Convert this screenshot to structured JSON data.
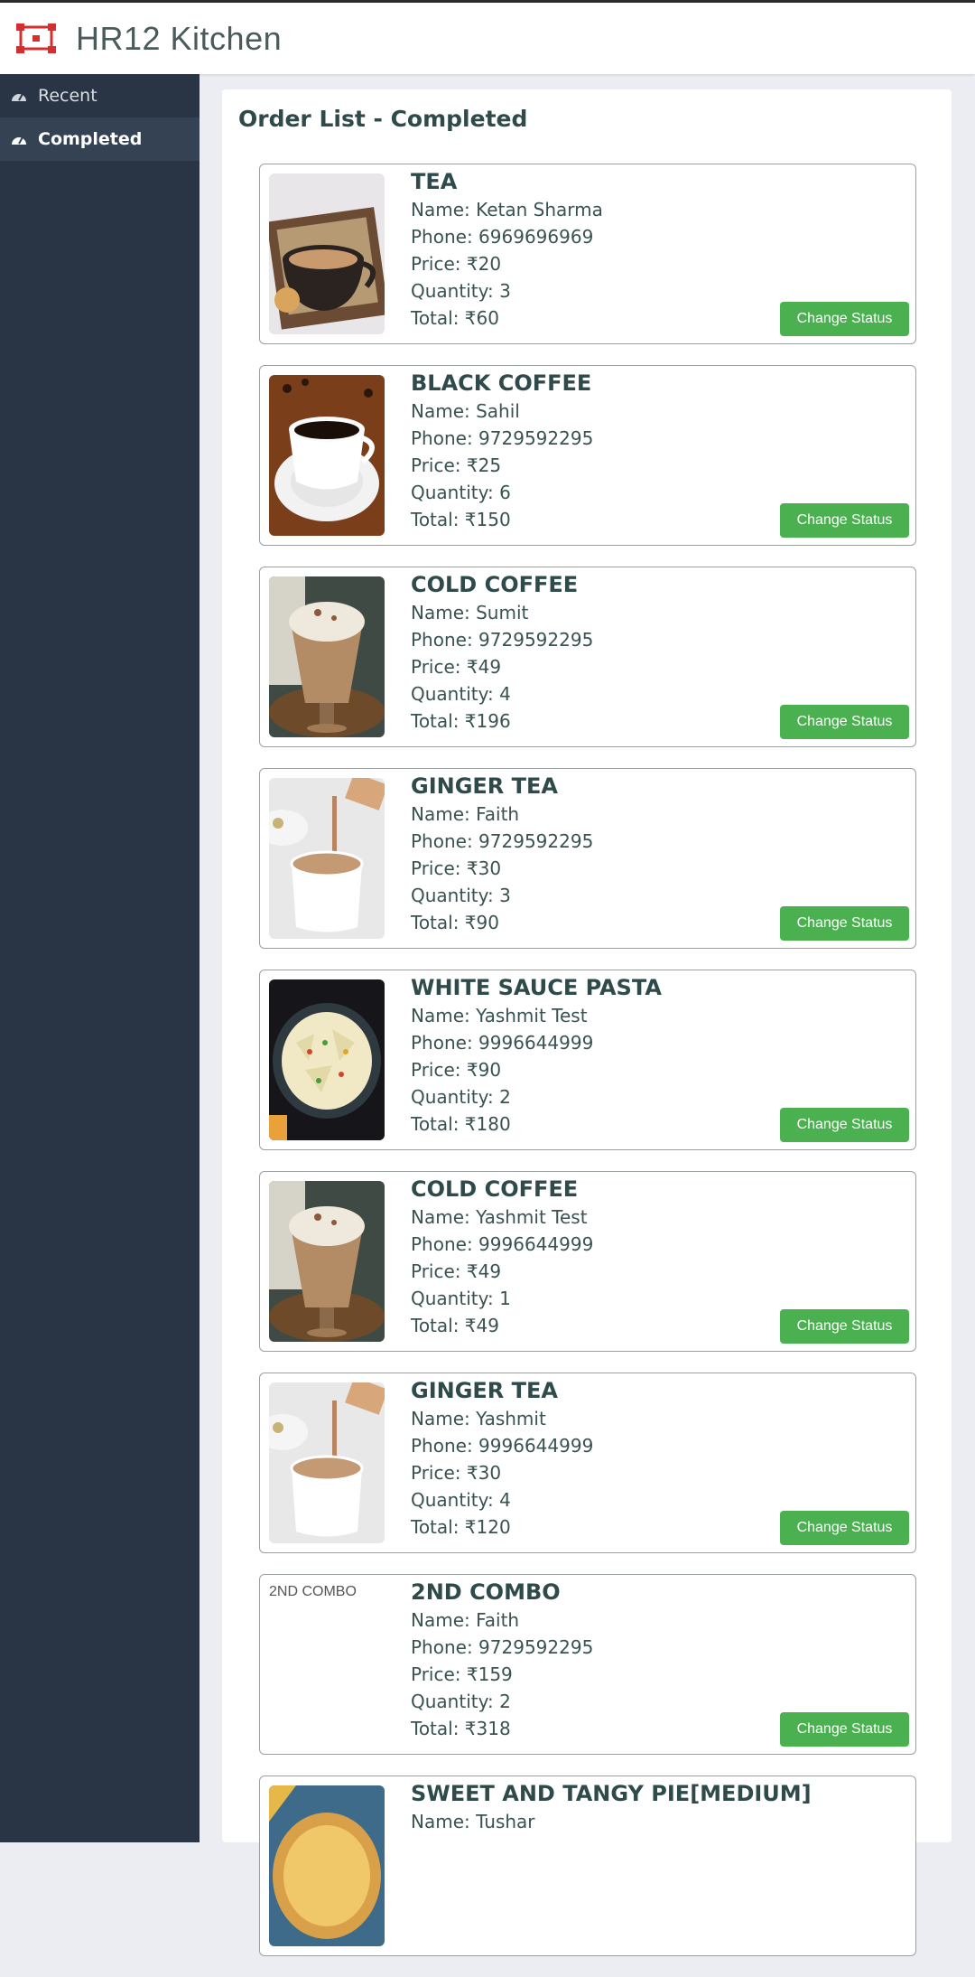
{
  "app": {
    "title": "HR12 Kitchen"
  },
  "sidebar": {
    "items": [
      {
        "label": "Recent"
      },
      {
        "label": "Completed"
      }
    ]
  },
  "main": {
    "title": "Order List - Completed"
  },
  "orders": [
    {
      "item": "TEA",
      "name": "Name: Ketan Sharma",
      "phone": "Phone: 6969696969",
      "price": "Price: ₹20",
      "quantity": "Quantity: 3",
      "total": "Total: ₹60",
      "button": "Change Status",
      "image": "tea"
    },
    {
      "item": "BLACK COFFEE",
      "name": "Name: Sahil",
      "phone": "Phone: 9729592295",
      "price": "Price: ₹25",
      "quantity": "Quantity: 6",
      "total": "Total: ₹150",
      "button": "Change Status",
      "image": "black-coffee"
    },
    {
      "item": "COLD COFFEE",
      "name": "Name: Sumit",
      "phone": "Phone: 9729592295",
      "price": "Price: ₹49",
      "quantity": "Quantity: 4",
      "total": "Total: ₹196",
      "button": "Change Status",
      "image": "cold-coffee"
    },
    {
      "item": "GINGER TEA",
      "name": "Name: Faith",
      "phone": "Phone: 9729592295",
      "price": "Price: ₹30",
      "quantity": "Quantity: 3",
      "total": "Total: ₹90",
      "button": "Change Status",
      "image": "ginger-tea"
    },
    {
      "item": "WHITE SAUCE PASTA",
      "name": "Name: Yashmit Test",
      "phone": "Phone: 9996644999",
      "price": "Price: ₹90",
      "quantity": "Quantity: 2",
      "total": "Total: ₹180",
      "button": "Change Status",
      "image": "pasta"
    },
    {
      "item": "COLD COFFEE",
      "name": "Name: Yashmit Test",
      "phone": "Phone: 9996644999",
      "price": "Price: ₹49",
      "quantity": "Quantity: 1",
      "total": "Total: ₹49",
      "button": "Change Status",
      "image": "cold-coffee"
    },
    {
      "item": "GINGER TEA",
      "name": "Name: Yashmit",
      "phone": "Phone: 9996644999",
      "price": "Price: ₹30",
      "quantity": "Quantity: 4",
      "total": "Total: ₹120",
      "button": "Change Status",
      "image": "ginger-tea"
    },
    {
      "item": "2ND COMBO",
      "name": "Name: Faith",
      "phone": "Phone: 9729592295",
      "price": "Price: ₹159",
      "quantity": "Quantity: 2",
      "total": "Total: ₹318",
      "button": "Change Status",
      "image": "broken",
      "image_alt": "2ND COMBO"
    },
    {
      "item": "SWEET AND TANGY PIE[MEDIUM]",
      "name": "Name: Tushar",
      "phone": "",
      "price": "",
      "quantity": "",
      "total": "",
      "button": "",
      "image": "pie"
    }
  ],
  "colors": {
    "sidebar": "#293544",
    "sidebar_active": "#354253",
    "button": "#4bb050",
    "background": "#ecedf3"
  }
}
